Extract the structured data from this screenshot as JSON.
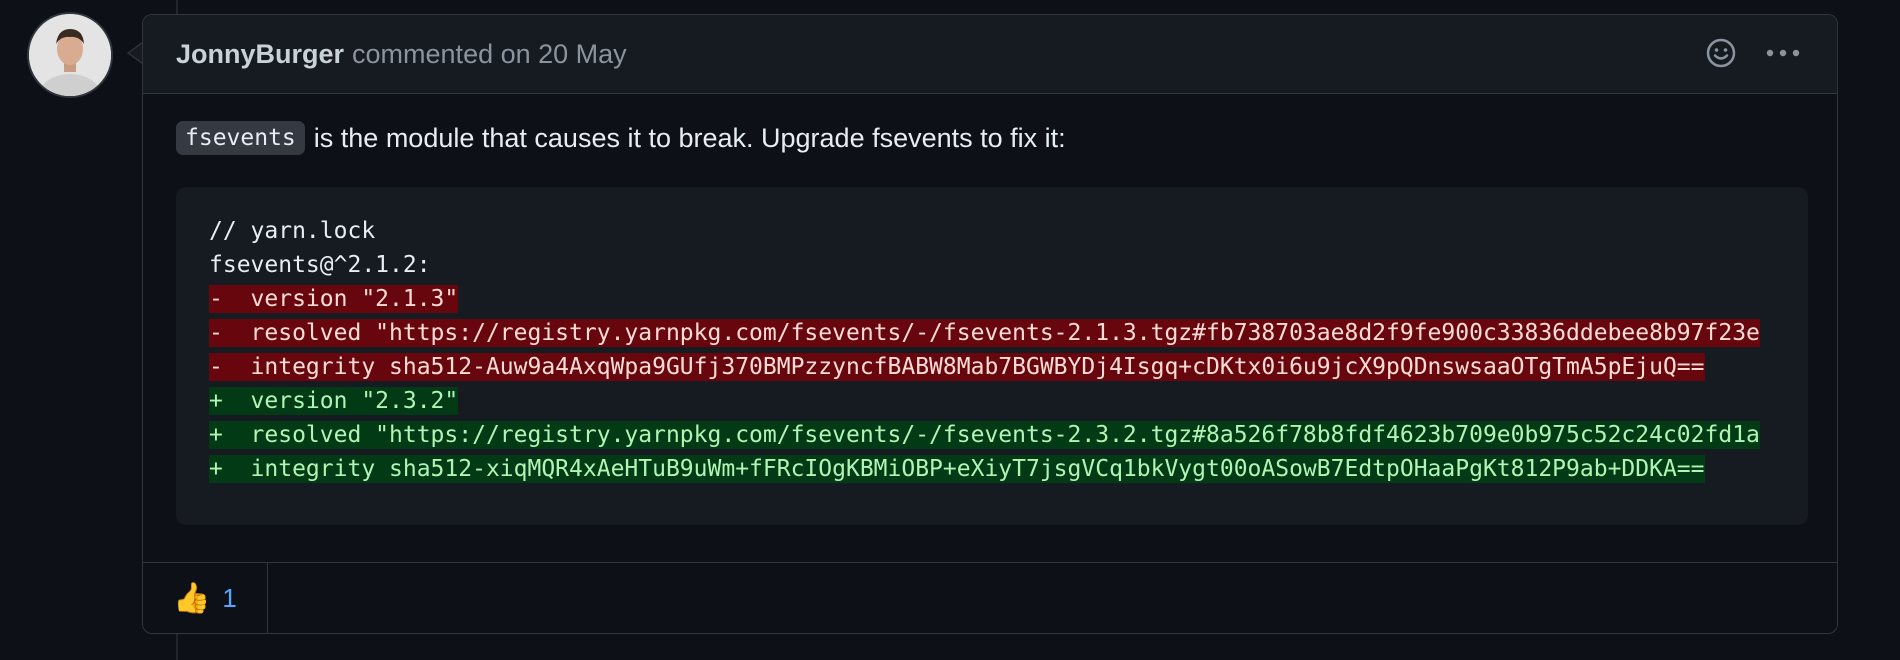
{
  "comment": {
    "author": "JonnyBurger",
    "action_text": "commented on 20 May",
    "inline_code": "fsevents",
    "paragraph_text": "is the module that causes it to break. Upgrade fsevents to fix it:",
    "code_lines": [
      "// yarn.lock",
      "fsevents@^2.1.2:",
      "-  version \"2.1.3\"",
      "-  resolved \"https://registry.yarnpkg.com/fsevents/-/fsevents-2.1.3.tgz#fb738703ae8d2f9fe900c33836ddebee8b97f23e",
      "-  integrity sha512-Auw9a4AxqWpa9GUfj370BMPzzyncfBABW8Mab7BGWBYDj4Isgq+cDKtx0i6u9jcX9pQDnswsaaOTgTmA5pEjuQ==",
      "+  version \"2.3.2\"",
      "+  resolved \"https://registry.yarnpkg.com/fsevents/-/fsevents-2.3.2.tgz#8a526f78b8fdf4623b709e0b975c52c24c02fd1a",
      "+  integrity sha512-xiqMQR4xAeHTuB9uWm+fFRcIOgKBMiOBP+eXiyT7jsgVCq1bkVygt00oASowB7EdtpOHaaPgKt812P9ab+DDKA=="
    ],
    "reaction_emoji": "👍",
    "reaction_count": "1"
  },
  "icons": {
    "emoji": "smiley-icon",
    "more": "kebab-horizontal-icon"
  }
}
